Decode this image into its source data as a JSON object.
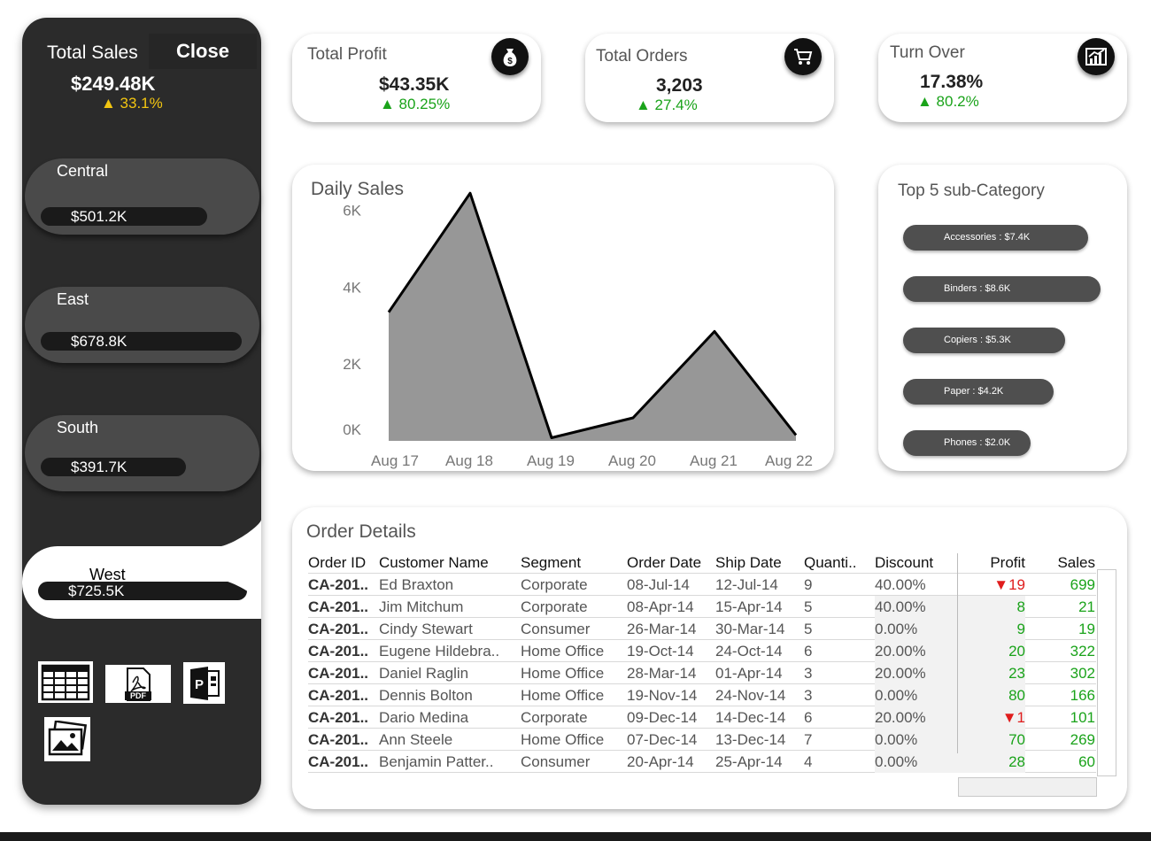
{
  "sidebar": {
    "title": "Total Sales",
    "close_label": "Close",
    "total": "$249.48K",
    "growth": "▲ 33.1%",
    "regions": [
      {
        "name": "Central",
        "value": "$501.2K",
        "bar_fraction": 0.69
      },
      {
        "name": "East",
        "value": "$678.8K",
        "bar_fraction": 0.94
      },
      {
        "name": "South",
        "value": "$391.7K",
        "bar_fraction": 0.54
      },
      {
        "name": "West",
        "value": "$725.5K",
        "bar_fraction": 1.0
      }
    ],
    "active_region": "West",
    "exports": [
      "table-export-icon",
      "pdf-export-icon",
      "powerpoint-export-icon",
      "image-export-icon"
    ],
    "pdf_text": "PDF",
    "ppt_text": "P"
  },
  "kpis": [
    {
      "label": "Total Profit",
      "value": "$43.35K",
      "growth": "▲ 80.25%",
      "icon": "money-bag-icon"
    },
    {
      "label": "Total Orders",
      "value": "3,203",
      "growth": "▲ 27.4%",
      "icon": "shopping-cart-icon"
    },
    {
      "label": "Turn Over",
      "value": "17.38%",
      "growth": "▲ 80.2%",
      "icon": "growth-chart-icon"
    }
  ],
  "colors": {
    "positive": "#1aa31a",
    "negative": "#e01d1d",
    "warning": "#f2c511",
    "sidebar": "#2b2b2b",
    "area_fill": "#979797"
  },
  "daily_sales": {
    "title": "Daily Sales"
  },
  "chart_data": {
    "type": "area",
    "title": "Daily Sales",
    "x": [
      "Aug 17",
      "Aug 18",
      "Aug 19",
      "Aug 20",
      "Aug 21",
      "Aug 22"
    ],
    "y_ticks": [
      "6K",
      "4K",
      "2K",
      "0K"
    ],
    "y_tick_values": [
      6000,
      4000,
      2000,
      0
    ],
    "series": [
      {
        "values": [
          3350,
          6450,
          80,
          600,
          2850,
          150
        ]
      }
    ],
    "ylim": [
      0,
      6500
    ],
    "grid": false
  },
  "top5": {
    "title": "Top 5 sub-Category",
    "items": [
      {
        "label": "Accessories : $7.4K",
        "value": 7.4
      },
      {
        "label": "Binders : $8.6K",
        "value": 8.6
      },
      {
        "label": "Copiers : $5.3K",
        "value": 5.3
      },
      {
        "label": "Paper : $4.2K",
        "value": 4.2
      },
      {
        "label": "Phones : $2.0K",
        "value": 2.0
      }
    ]
  },
  "orders": {
    "title": "Order Details",
    "columns": [
      "Order ID",
      "Customer Name",
      "Segment",
      "Order Date",
      "Ship Date",
      "Quanti..",
      "Discount",
      "Profit",
      "Sales"
    ],
    "rows": [
      {
        "id": "CA-201..",
        "customer": "Ed Braxton",
        "segment": "Corporate",
        "order_date": "08-Jul-14",
        "ship_date": "12-Jul-14",
        "qty": "9",
        "discount": "40.00%",
        "profit": "▼19",
        "sales": "699",
        "neg": true
      },
      {
        "id": "CA-201..",
        "customer": "Jim Mitchum",
        "segment": "Corporate",
        "order_date": "08-Apr-14",
        "ship_date": "15-Apr-14",
        "qty": "5",
        "discount": "40.00%",
        "profit": "8",
        "sales": "21",
        "neg": false
      },
      {
        "id": "CA-201..",
        "customer": "Cindy Stewart",
        "segment": "Consumer",
        "order_date": "26-Mar-14",
        "ship_date": "30-Mar-14",
        "qty": "5",
        "discount": "0.00%",
        "profit": "9",
        "sales": "19",
        "neg": false
      },
      {
        "id": "CA-201..",
        "customer": "Eugene Hildebra..",
        "segment": "Home Office",
        "order_date": "19-Oct-14",
        "ship_date": "24-Oct-14",
        "qty": "6",
        "discount": "20.00%",
        "profit": "20",
        "sales": "322",
        "neg": false
      },
      {
        "id": "CA-201..",
        "customer": "Daniel Raglin",
        "segment": "Home Office",
        "order_date": "28-Mar-14",
        "ship_date": "01-Apr-14",
        "qty": "3",
        "discount": "20.00%",
        "profit": "23",
        "sales": "302",
        "neg": false
      },
      {
        "id": "CA-201..",
        "customer": "Dennis Bolton",
        "segment": "Home Office",
        "order_date": "19-Nov-14",
        "ship_date": "24-Nov-14",
        "qty": "3",
        "discount": "0.00%",
        "profit": "80",
        "sales": "166",
        "neg": false
      },
      {
        "id": "CA-201..",
        "customer": "Dario Medina",
        "segment": "Corporate",
        "order_date": "09-Dec-14",
        "ship_date": "14-Dec-14",
        "qty": "6",
        "discount": "20.00%",
        "profit": "▼1",
        "sales": "101",
        "neg": true
      },
      {
        "id": "CA-201..",
        "customer": "Ann Steele",
        "segment": "Home Office",
        "order_date": "07-Dec-14",
        "ship_date": "13-Dec-14",
        "qty": "7",
        "discount": "0.00%",
        "profit": "70",
        "sales": "269",
        "neg": false
      },
      {
        "id": "CA-201..",
        "customer": "Benjamin Patter..",
        "segment": "Consumer",
        "order_date": "20-Apr-14",
        "ship_date": "25-Apr-14",
        "qty": "4",
        "discount": "0.00%",
        "profit": "28",
        "sales": "60",
        "neg": false
      }
    ]
  }
}
